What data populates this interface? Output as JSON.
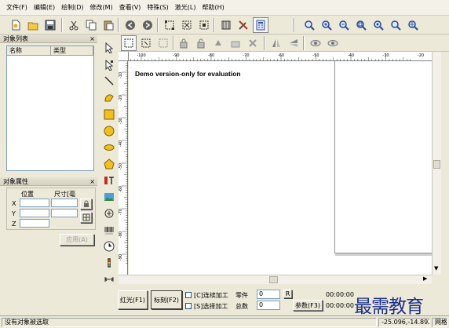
{
  "menu": [
    "文件(F)",
    "编辑(E)",
    "绘制(D)",
    "修改(M)",
    "查看(V)",
    "特殊(S)",
    "激光(L)",
    "帮助(H)"
  ],
  "object_list": {
    "title": "对象列表",
    "close": "×",
    "columns": [
      "名称",
      "类型"
    ]
  },
  "object_props": {
    "title": "对象属性",
    "close": "×",
    "position_label": "位置",
    "size_label": "尺寸[毫",
    "axes": [
      "X",
      "Y",
      "Z"
    ],
    "apply_button": "应用(A)"
  },
  "canvas": {
    "watermark": "Demo version-only for evaluation"
  },
  "rulers": {
    "h_ticks": [
      "-100",
      "-90",
      "-80",
      "-70",
      "-60",
      "-50",
      "-40",
      "-30",
      "-20",
      "-10"
    ],
    "v_ticks": [
      "-10",
      "-20",
      "-30",
      "-40",
      "-50",
      "-60",
      "-70",
      "-80",
      "-90",
      "-100"
    ]
  },
  "bottom": {
    "red_light": "红光(F1)",
    "mark": "标刻(F2)",
    "continuous": "[C]连续加工",
    "select_process": "[S]选择加工",
    "parts_label": "零件",
    "parts_value": "0",
    "total_label": "总数",
    "total_value": "0",
    "r_button": "R",
    "param_button": "参数(F3)",
    "time1": "00:00:00",
    "time2": "00:00:00"
  },
  "status": {
    "message": "没有对象被选取",
    "coords": "-25.096,-14.892",
    "grid": "网格"
  },
  "overlay_logo": "最需教育",
  "colors": {
    "canvas_bg": "#ffffff",
    "logo": "#1a2f8a",
    "window_bg": "#ece9d8"
  }
}
